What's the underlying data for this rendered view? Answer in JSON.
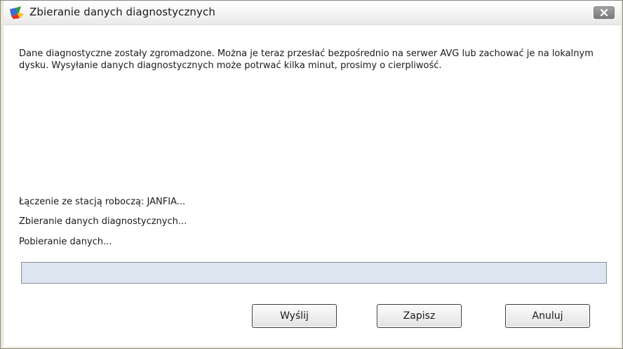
{
  "window": {
    "title": "Zbieranie danych diagnostycznych",
    "icon": "avg-logo-icon",
    "close_icon": "close-icon"
  },
  "main": {
    "description": "Dane diagnostyczne zostały zgromadzone. Można je teraz przesłać bezpośrednio na serwer AVG lub zachować je na lokalnym dysku. Wysyłanie danych diagnostycznych może potrwać kilka minut, prosimy o cierpliwość.",
    "status_lines": [
      "Łączenie ze stacją roboczą: JANFIA...",
      "Zbieranie danych diagnostycznych...",
      "Pobieranie danych..."
    ],
    "progress": 0
  },
  "buttons": {
    "send_label": "Wyślij",
    "save_label": "Zapisz",
    "cancel_label": "Anuluj"
  },
  "colors": {
    "close_button": "#8e8e8e",
    "progress_track": "#dde6f0"
  }
}
